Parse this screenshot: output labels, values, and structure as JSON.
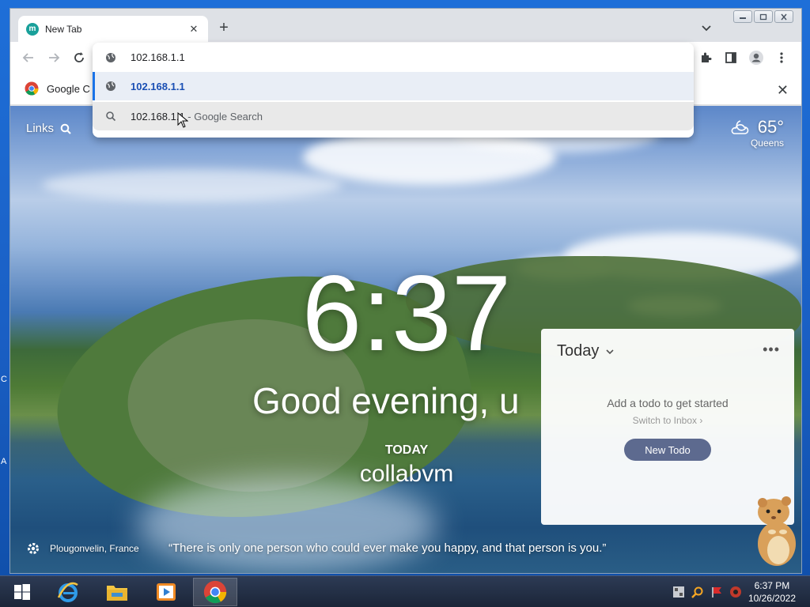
{
  "browser": {
    "tab": {
      "favicon_letter": "m",
      "title": "New Tab",
      "close": "✕"
    },
    "new_tab_symbol": "+",
    "toolbar": {
      "back": "←",
      "forward": "→"
    },
    "bookmarks": {
      "item_label": "Google C",
      "close": "✕"
    }
  },
  "omnibox": {
    "input_value": "102.168.1.1",
    "suggestions": [
      {
        "text": "102.168.1.1",
        "hint": ""
      },
      {
        "text": "102.168.1.1",
        "hint": " - Google Search"
      }
    ]
  },
  "momentum": {
    "links_label": "Links",
    "weather": {
      "temp": "65°",
      "location": "Queens"
    },
    "clock": "6:37",
    "greeting": "Good evening, u",
    "focus_label": "TODAY",
    "focus_value": "collabvm",
    "photo_location": "Plougonvelin, France",
    "quote": "“There is only one person who could ever make you happy, and that person is you.”",
    "todo": {
      "list_name": "Today",
      "empty_text": "Add a todo to get started",
      "switch_text": "Switch to Inbox ›",
      "new_button": "New Todo",
      "more": "•••"
    }
  },
  "taskbar": {
    "time": "6:37 PM",
    "date": "10/26/2022"
  },
  "desktop_edge_letters": [
    "C",
    "A"
  ],
  "colors": {
    "tab_favicon": "#19a09a",
    "todo_button": "#5d6a8f",
    "omnibox_accent": "#1a73e8",
    "taskbar": "#1b2538"
  }
}
